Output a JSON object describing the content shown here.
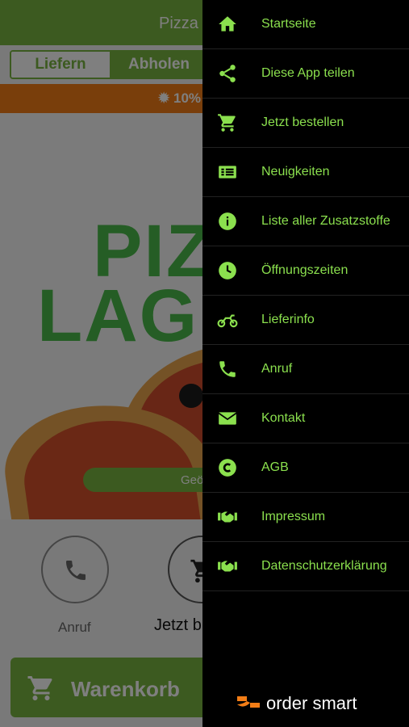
{
  "app": {
    "title": "Pizza L",
    "tabs": {
      "deliver": "Liefern",
      "pickup": "Abholen"
    },
    "promo": "10%",
    "brand": {
      "line1": "PIZ",
      "line2": "LAG"
    },
    "cta": "Geö",
    "actions": {
      "call": "Anruf",
      "order": "Jetzt b"
    },
    "cart": "Warenkorb",
    "accent": "#79b541",
    "promo_color": "#f27d16"
  },
  "drawer": {
    "items": [
      {
        "label": "Startseite",
        "icon": "home-icon"
      },
      {
        "label": "Diese App teilen",
        "icon": "share-icon"
      },
      {
        "label": "Jetzt bestellen",
        "icon": "cart-icon"
      },
      {
        "label": "Neuigkeiten",
        "icon": "news-icon"
      },
      {
        "label": "Liste aller Zusatzstoffe",
        "icon": "info-icon"
      },
      {
        "label": "Öffnungszeiten",
        "icon": "clock-icon"
      },
      {
        "label": "Lieferinfo",
        "icon": "motorcycle-icon"
      },
      {
        "label": "Anruf",
        "icon": "phone-icon"
      },
      {
        "label": "Kontakt",
        "icon": "mail-icon"
      },
      {
        "label": "AGB",
        "icon": "copyright-icon"
      },
      {
        "label": "Impressum",
        "icon": "handshake-icon"
      },
      {
        "label": "Datenschutzerklärung",
        "icon": "handshake-icon"
      }
    ],
    "icon_color": "#8be04e",
    "logo": "order smart",
    "logo_color": "#f27d16"
  }
}
